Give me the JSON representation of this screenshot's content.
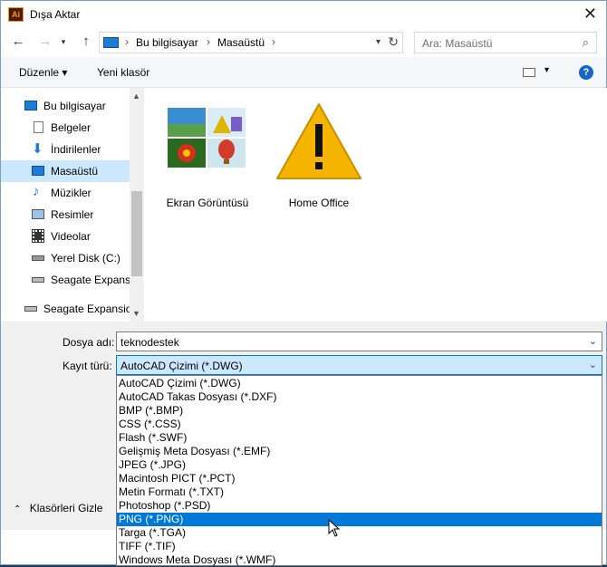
{
  "window": {
    "title": "Dışa Aktar",
    "app_icon": "Ai",
    "close": "✕"
  },
  "address": {
    "crumbs": [
      "Bu bilgisayar",
      "Masaüstü"
    ],
    "search_placeholder": "Ara: Masaüstü"
  },
  "toolbar": {
    "organize": "Düzenle ▾",
    "new_folder": "Yeni klasör"
  },
  "sidebar": {
    "items": [
      {
        "label": "Bu bilgisayar",
        "icon": "computer-icon"
      },
      {
        "label": "Belgeler",
        "icon": "documents-icon"
      },
      {
        "label": "İndirilenler",
        "icon": "downloads-icon"
      },
      {
        "label": "Masaüstü",
        "icon": "desktop-icon",
        "selected": true
      },
      {
        "label": "Müzikler",
        "icon": "music-icon"
      },
      {
        "label": "Resimler",
        "icon": "pictures-icon"
      },
      {
        "label": "Videolar",
        "icon": "videos-icon"
      },
      {
        "label": "Yerel Disk (C:)",
        "icon": "local-disk-icon"
      },
      {
        "label": "Seagate Expansion",
        "icon": "drive-icon"
      },
      {
        "label": "Seagate Expansion",
        "icon": "drive-icon"
      }
    ]
  },
  "files": [
    {
      "label": "Ekran Görüntüsü",
      "icon": "image-folder-icon"
    },
    {
      "label": "Home Office",
      "icon": "warning-icon"
    }
  ],
  "form": {
    "filename_label": "Dosya adı:",
    "filename_value": "teknodestek",
    "filetype_label": "Kayıt türü:",
    "filetype_value": "AutoCAD Çizimi (*.DWG)"
  },
  "filetype_options": [
    "AutoCAD Çizimi (*.DWG)",
    "AutoCAD Takas Dosyası (*.DXF)",
    "BMP (*.BMP)",
    "CSS (*.CSS)",
    "Flash (*.SWF)",
    "Gelişmiş Meta Dosyası (*.EMF)",
    "JPEG (*.JPG)",
    "Macintosh PICT (*.PCT)",
    "Metin Formatı (*.TXT)",
    "Photoshop (*.PSD)",
    "PNG (*.PNG)",
    "Targa (*.TGA)",
    "TIFF (*.TIF)",
    "Windows Meta Dosyası (*.WMF)"
  ],
  "hovered_option_index": 10,
  "hide_folders": "Klasörleri Gizle",
  "colors": {
    "accent": "#0078d7",
    "selection": "#cce8ff"
  }
}
